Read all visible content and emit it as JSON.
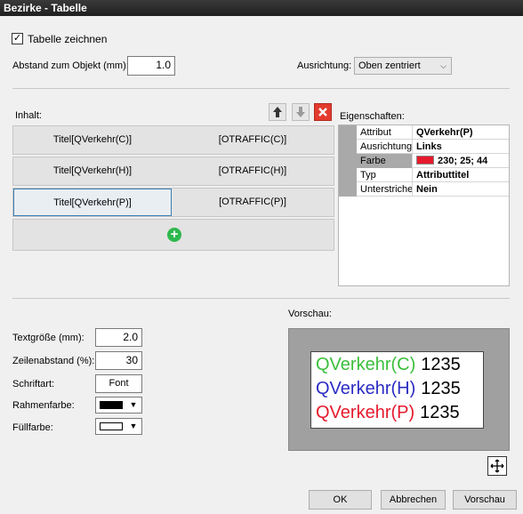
{
  "window": {
    "title": "Bezirke - Tabelle"
  },
  "options": {
    "draw_table_label": "Tabelle zeichnen",
    "draw_table_checked": true,
    "distance_label": "Abstand zum Objekt (mm):",
    "distance_value": "1.0",
    "alignment_label": "Ausrichtung:",
    "alignment_value": "Oben zentriert"
  },
  "content": {
    "label": "Inhalt:",
    "rows": [
      {
        "title": "Titel[QVerkehr(C)]",
        "value": "[OTRAFFIC(C)]"
      },
      {
        "title": "Titel[QVerkehr(H)]",
        "value": "[OTRAFFIC(H)]"
      },
      {
        "title": "Titel[QVerkehr(P)]",
        "value": "[OTRAFFIC(P)]"
      }
    ],
    "add_symbol": "+"
  },
  "properties": {
    "label": "Eigenschaften:",
    "rows": [
      {
        "name": "Attribut",
        "value": "QVerkehr(P)"
      },
      {
        "name": "Ausrichtung",
        "value": "Links"
      },
      {
        "name": "Farbe",
        "value": "230; 25; 44",
        "color": "#e6192c"
      },
      {
        "name": "Typ",
        "value": "Attributtitel"
      },
      {
        "name": "Unterstriche",
        "value": "Nein"
      }
    ]
  },
  "format": {
    "text_size_label": "Textgröße (mm):",
    "text_size_value": "2.0",
    "line_spacing_label": "Zeilenabstand (%):",
    "line_spacing_value": "30",
    "font_label": "Schriftart:",
    "font_button": "Font",
    "frame_color_label": "Rahmenfarbe:",
    "frame_color": "#000000",
    "fill_color_label": "Füllfarbe:",
    "fill_color": "#ffffff"
  },
  "preview": {
    "label": "Vorschau:",
    "lines": [
      {
        "text": "QVerkehr(C)",
        "value": "1235",
        "color": "#3bbf3b"
      },
      {
        "text": "QVerkehr(H)",
        "value": "1235",
        "color": "#2b2bc4"
      },
      {
        "text": "QVerkehr(P)",
        "value": "1235",
        "color": "#e6192c"
      }
    ]
  },
  "buttons": {
    "ok": "OK",
    "cancel": "Abbrechen",
    "preview": "Vorschau"
  }
}
